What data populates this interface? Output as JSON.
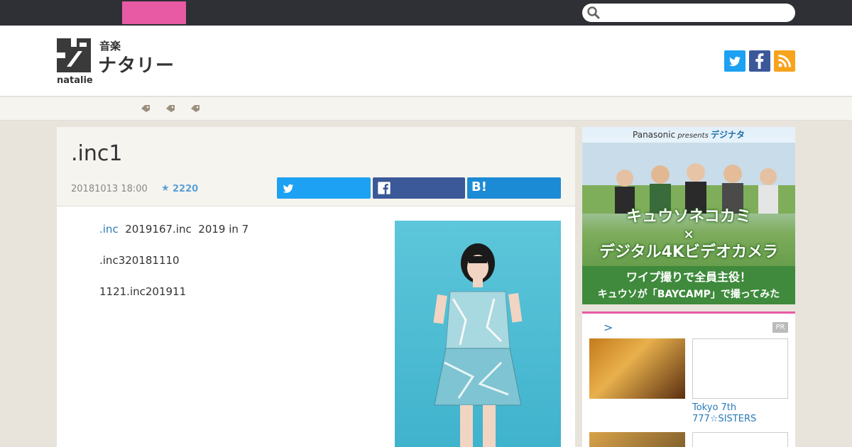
{
  "header": {
    "search_placeholder": "",
    "logo": {
      "genre": "音楽",
      "name": "ナタリー",
      "sub": "natalie"
    }
  },
  "article": {
    "title": ".inc1",
    "date": "20181013 18:00",
    "star_count": "2220",
    "hatena_label": "B!",
    "paragraphs": [
      {
        "link": ".inc",
        "text": "  2019167.inc  2019 in 7"
      },
      {
        "text": ".inc320181110"
      },
      {
        "text": "1121.inc201911"
      }
    ]
  },
  "ad": {
    "brand": "Panasonic",
    "presents": " presents ",
    "product": "デジナタ",
    "headline_1": "キュウソネコカミ",
    "headline_x": "×",
    "headline_2": "デジタル4Kビデオカメラ",
    "bottom_1": "ワイプ撮りで全員主役！",
    "bottom_2": "キュウソが「BAYCAMP」で撮ってみた"
  },
  "pr": {
    "chevron": ">",
    "badge": "PR",
    "caption": "Tokyo 7th 777☆SISTERS"
  },
  "colors": {
    "topbar": "#2e3035",
    "accent_pink": "#e85aa4",
    "twitter": "#1da1f2",
    "facebook": "#3b5998",
    "rss": "#f7a31c",
    "link": "#2a7ab8"
  },
  "icons": [
    "search-icon",
    "twitter-icon",
    "facebook-icon",
    "rss-icon",
    "tag-icon",
    "star-icon",
    "hatena-icon"
  ]
}
